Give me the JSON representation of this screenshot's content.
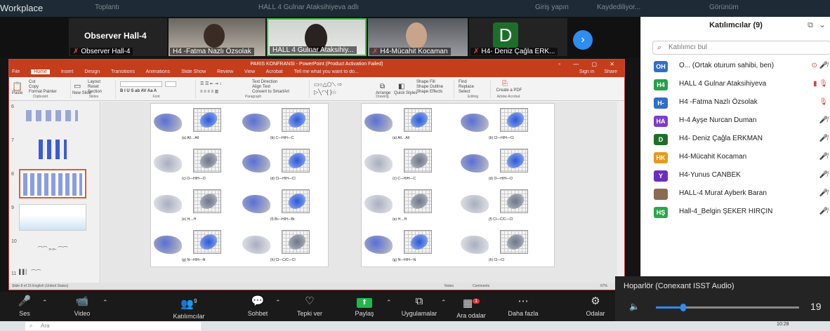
{
  "window": {
    "title": "Workplace",
    "tab_meeting": "Toplantı",
    "tab_hall": "HALL 4 Gulnar Ataksihiyeva adlı",
    "tab_share": "Giriş yapın",
    "tab_record": "Kaydediliyor...",
    "tab_view": "Görünüm"
  },
  "videos": [
    {
      "name": "Observer Hall-4",
      "big": "Observer Hall-4",
      "type": "text"
    },
    {
      "name": "H4 -Fatma Nazlı Özsolak",
      "type": "photo"
    },
    {
      "name": "HALL 4  Gulnar Ataksihiy...",
      "type": "photo"
    },
    {
      "name": "H4-Mücahit Kocaman",
      "type": "photo"
    },
    {
      "name": "H4- Deniz Çağla ERK...",
      "type": "letter",
      "letter": "D"
    }
  ],
  "ppt": {
    "title": "PARIS KONFRANSI - PowerPoint (Product Activation Failed)",
    "tell": "Tell me what you want to do...",
    "signin": "Sign in",
    "share": "Share",
    "menus": [
      "File",
      "Home",
      "Insert",
      "Design",
      "Transitions",
      "Animations",
      "Slide Show",
      "Review",
      "View",
      "Acrobat"
    ],
    "ribbon": {
      "paste": "Paste",
      "cut": "Cut",
      "copy": "Copy",
      "format_painter": "Format Painter",
      "clipboard": "Clipboard",
      "new_slide": "New Slide",
      "layout": "Layout",
      "reset": "Reset",
      "section": "Section",
      "slides": "Slides",
      "font": "Font",
      "text_direction": "Text Direction",
      "align_text": "Align Text",
      "smartart": "Convert to SmartArt",
      "paragraph": "Paragraph",
      "arrange": "Arrange",
      "quick_styles": "Quick Styles",
      "shape_fill": "Shape Fill",
      "shape_outline": "Shape Outline",
      "shape_effects": "Shape Effects",
      "drawing": "Drawing",
      "find": "Find",
      "replace": "Replace",
      "select": "Select",
      "editing": "Editing",
      "create_pdf": "Create a PDF",
      "adobe": "Adobe Acrobat"
    },
    "slide_numbers": [
      "6",
      "7",
      "8",
      "9",
      "10",
      "11"
    ],
    "captions_left": [
      "(a) All....All",
      "(b)  C—H/H—C",
      "(c) O—H/H—O",
      "(d)  Cl—H/H—Cl",
      "(e)  H....H",
      "(f)  Br—H/H—Br",
      "(g)  N—H/H—N",
      "(h)  Cl—C/C—Cl"
    ],
    "captions_right": [
      "(a) All....All",
      "(b)  Cl—H/H—Cl",
      "(c) C—H/H—C",
      "(d)  O—H/H—O",
      "(e)  H....H",
      "(f)  Cl—C/C—Cl",
      "(g)  N—H/H—N",
      "(h)  Cl—Cl"
    ],
    "status": "Slide 8 of 15     English (United States)",
    "notes": "Notes",
    "comments": "Comments",
    "zoom": "67%"
  },
  "participants": {
    "header": "Katılımcılar (9)",
    "search_placeholder": "Katılımcı bul",
    "list": [
      {
        "initials": "OH",
        "name": "O... (Ortak oturum sahibi, ben)",
        "color": "#2f6fc6",
        "status": "⊙ 🎤̸"
      },
      {
        "initials": "H4",
        "name": "HALL 4  Gulnar Ataksihiyeva",
        "color": "#27a04a",
        "status": "▮ 🎙"
      },
      {
        "initials": "H-",
        "name": "H4 -Fatma Nazlı Özsolak",
        "color": "#2f6fc6",
        "status": "🎙"
      },
      {
        "initials": "HA",
        "name": "H-4 Ayşe Nurcan Duman",
        "color": "#7b3fc4",
        "status": "🎤̸"
      },
      {
        "initials": "D",
        "name": "H4- Deniz Çağla ERKMAN",
        "color": "#1e6e2b",
        "status": "🎤̸"
      },
      {
        "initials": "HK",
        "name": "H4-Mücahit Kocaman",
        "color": "#e39a1e",
        "status": "🎤̸"
      },
      {
        "initials": "Y",
        "name": "H4-Yunus CANBEK",
        "color": "#6b2fbf",
        "status": "🎤̸"
      },
      {
        "initials": "",
        "name": "HALL-4 Murat Ayberk Baran",
        "color": "#8a6b52",
        "status": "🎤̸"
      },
      {
        "initials": "HŞ",
        "name": "Hall-4_Belgin ŞEKER HIRÇIN",
        "color": "#2aa84a",
        "status": "🎤̸"
      }
    ]
  },
  "speaker": {
    "title": "Hoparlör (Conexant ISST Audio)",
    "volume": "19",
    "level": 0.19
  },
  "controls": [
    {
      "label": "Ses",
      "icon": "🎤"
    },
    {
      "label": "Video",
      "icon": "📹"
    },
    {
      "label": "Katılımcılar",
      "icon": "👥",
      "count": "9"
    },
    {
      "label": "Sohbet",
      "icon": "💬"
    },
    {
      "label": "Tepki ver",
      "icon": "♡"
    },
    {
      "label": "Paylaş",
      "icon": "⬆"
    },
    {
      "label": "Uygulamalar",
      "icon": "⧉"
    },
    {
      "label": "Ara odalar",
      "icon": "▦",
      "badge": "1"
    },
    {
      "label": "Daha fazla",
      "icon": "⋯"
    },
    {
      "label": "Odalar",
      "icon": "⚙"
    }
  ],
  "taskbar": {
    "search": "Ara",
    "clock": "10:28"
  }
}
